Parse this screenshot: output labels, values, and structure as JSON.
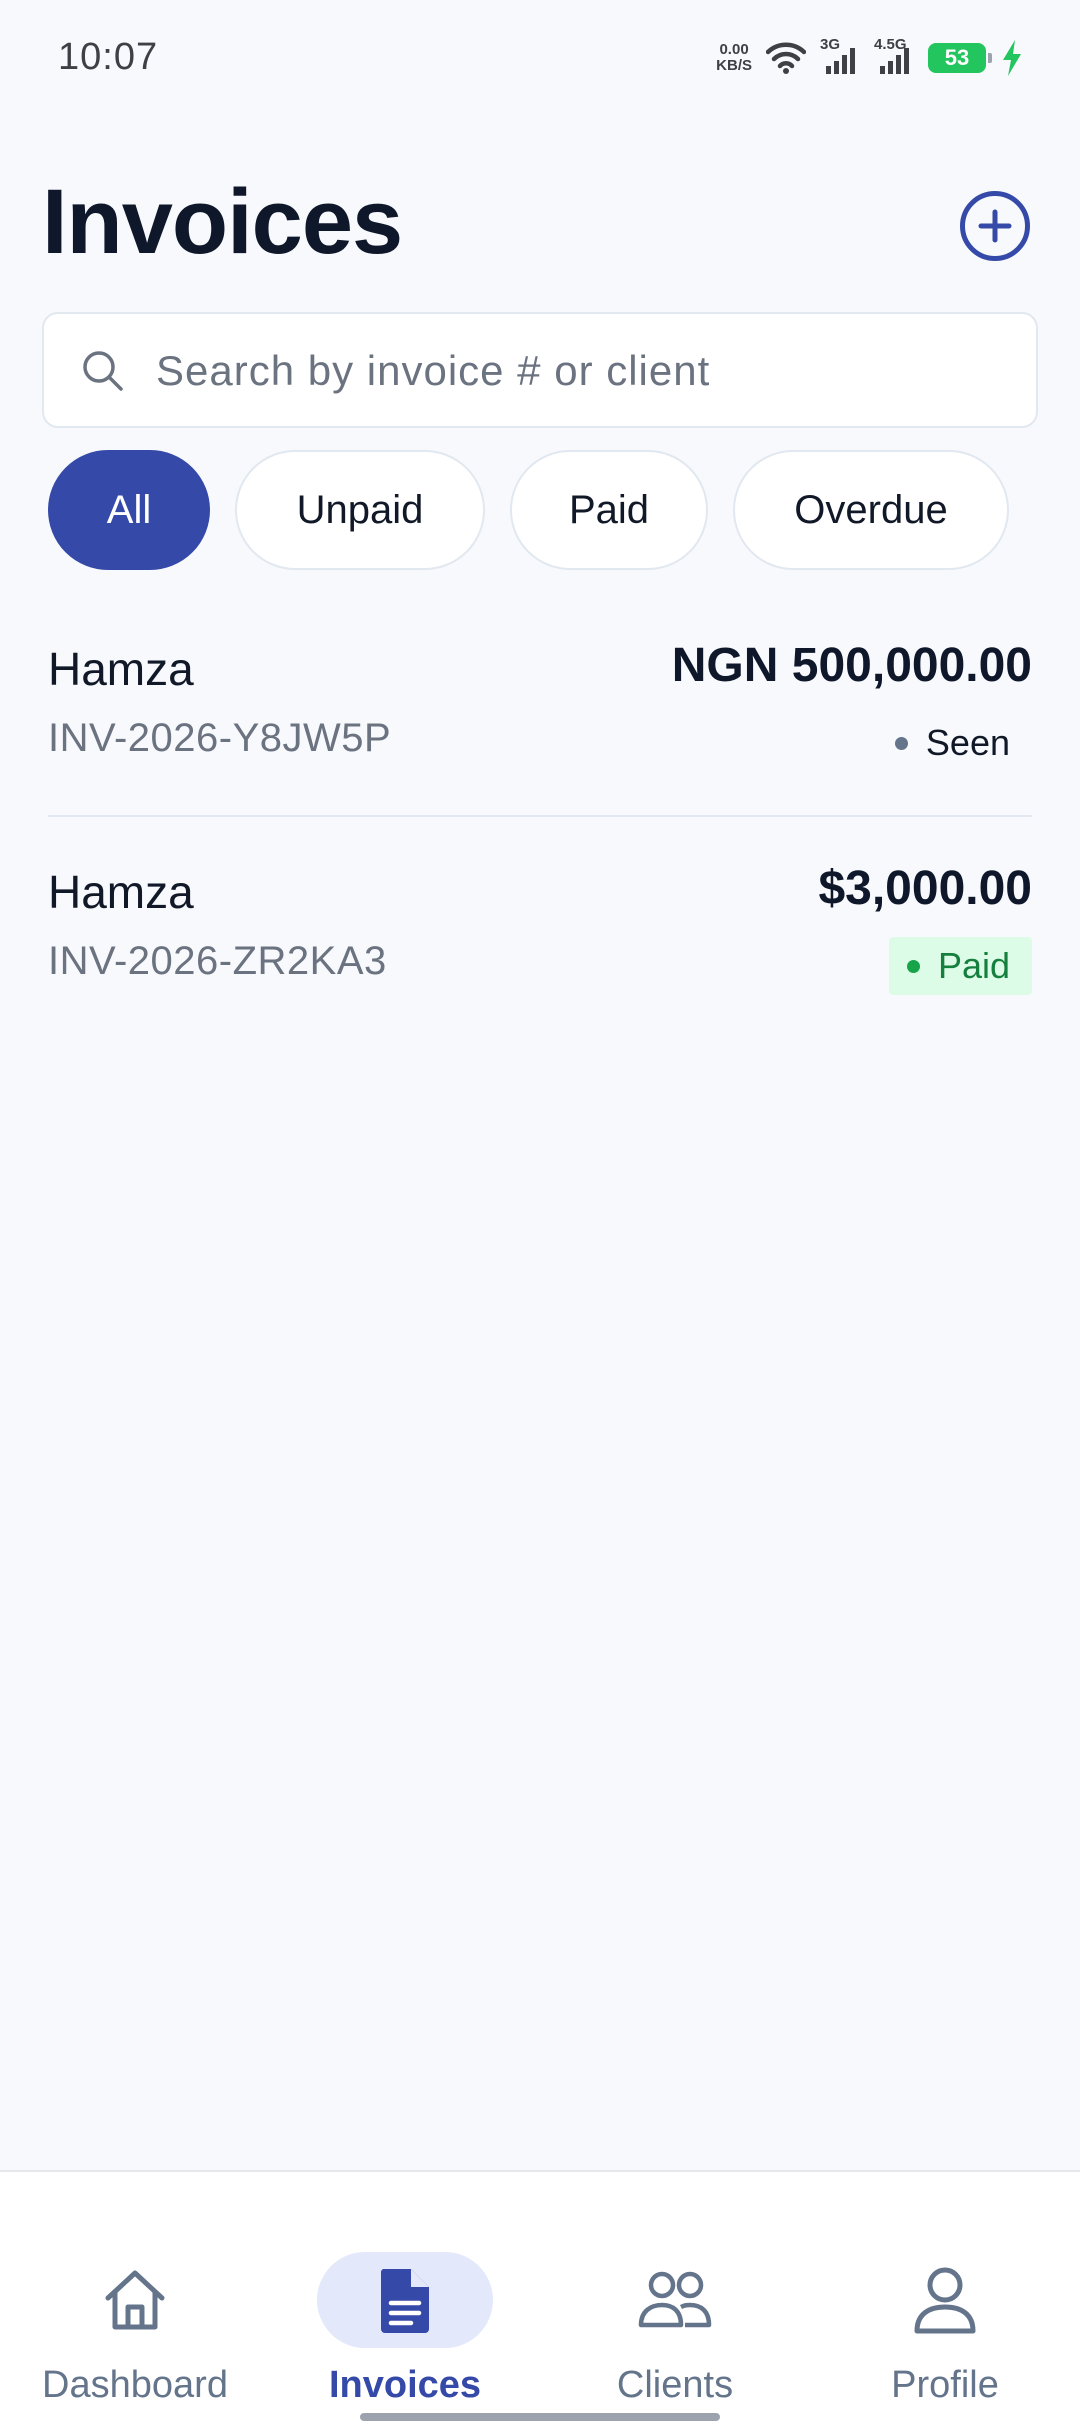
{
  "status_bar": {
    "time": "10:07",
    "net_speed_value": "0.00",
    "net_speed_unit": "KB/S",
    "signal1_label": "3G",
    "signal2_label": "4.5G",
    "battery_level": "53"
  },
  "header": {
    "title": "Invoices",
    "add_icon": "plus-circle-icon"
  },
  "search": {
    "placeholder": "Search by invoice # or client",
    "value": "",
    "icon": "search-icon"
  },
  "filters": [
    {
      "label": "All",
      "active": true
    },
    {
      "label": "Unpaid",
      "active": false
    },
    {
      "label": "Paid",
      "active": false
    },
    {
      "label": "Overdue",
      "active": false
    }
  ],
  "invoices": [
    {
      "client": "Hamza",
      "number": "INV-2026-Y8JW5P",
      "amount": "NGN 500,000.00",
      "status": "Seen"
    },
    {
      "client": "Hamza",
      "number": "INV-2026-ZR2KA3",
      "amount": "$3,000.00",
      "status": "Paid"
    }
  ],
  "bottom_nav": [
    {
      "label": "Dashboard",
      "icon": "home-icon",
      "active": false
    },
    {
      "label": "Invoices",
      "icon": "document-icon",
      "active": true
    },
    {
      "label": "Clients",
      "icon": "users-icon",
      "active": false
    },
    {
      "label": "Profile",
      "icon": "user-icon",
      "active": false
    }
  ],
  "colors": {
    "accent": "#3549a8",
    "background": "#f7f9fc",
    "paid_green": "#15803d",
    "paid_bg": "#dcfce7",
    "muted": "#6b7280"
  }
}
